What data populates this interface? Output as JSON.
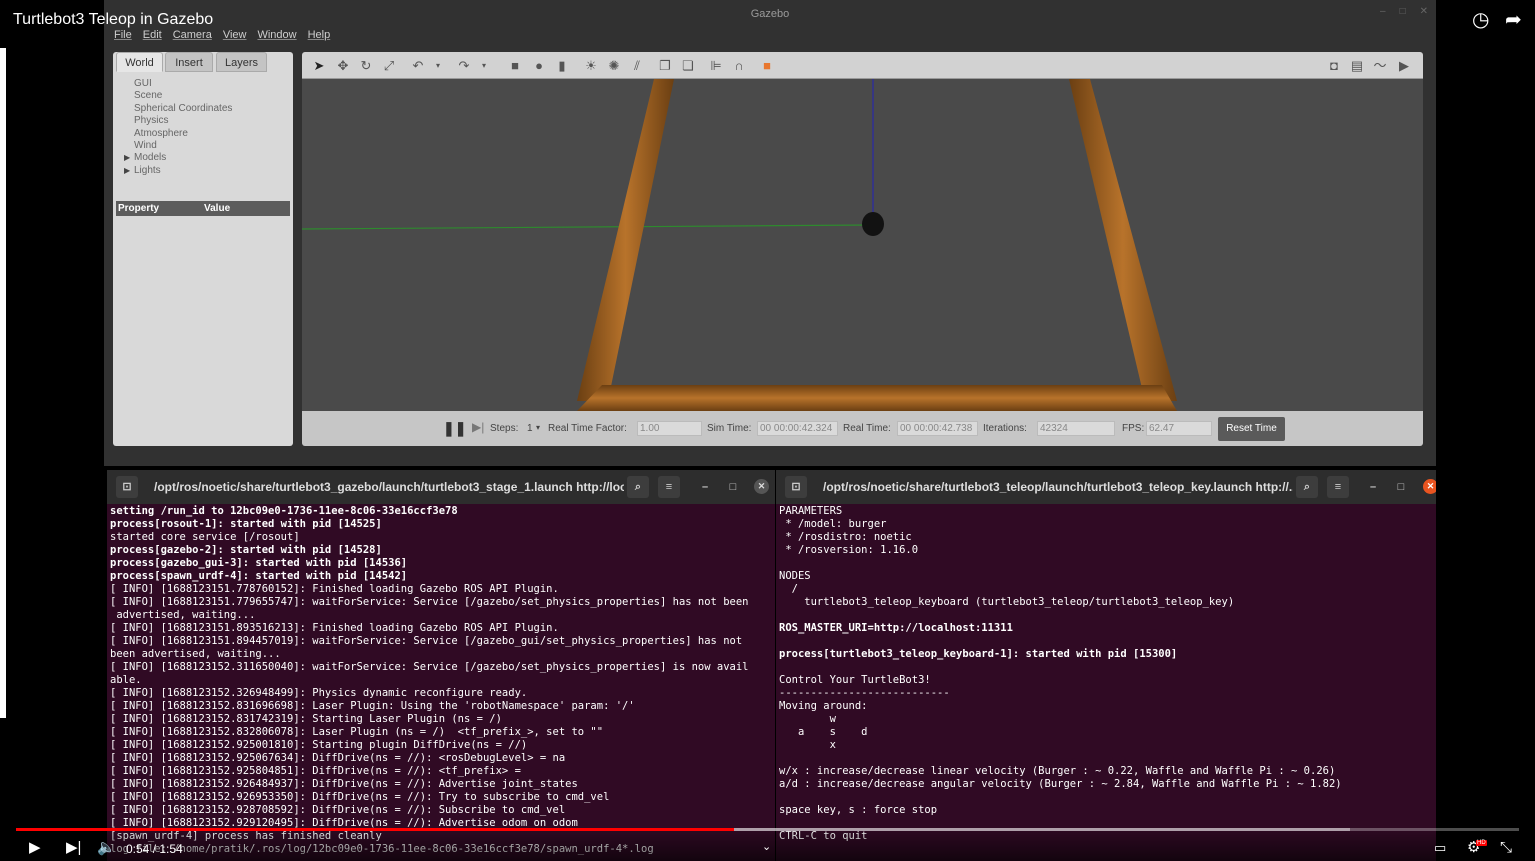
{
  "video": {
    "title": "Turtlebot3 Teleop in Gazebo",
    "time": "0:54 / 1:54",
    "progress": 0.474,
    "buffered": 0.887,
    "hd_badge": "HD"
  },
  "gazebo": {
    "window_title": "Gazebo",
    "menu": [
      "File",
      "Edit",
      "Camera",
      "View",
      "Window",
      "Help"
    ],
    "tabs": [
      "World",
      "Insert",
      "Layers"
    ],
    "tree": [
      {
        "label": "GUI",
        "expandable": false
      },
      {
        "label": "Scene",
        "expandable": false
      },
      {
        "label": "Spherical Coordinates",
        "expandable": false
      },
      {
        "label": "Physics",
        "expandable": false
      },
      {
        "label": "Atmosphere",
        "expandable": false
      },
      {
        "label": "Wind",
        "expandable": false
      },
      {
        "label": "Models",
        "expandable": true
      },
      {
        "label": "Lights",
        "expandable": true
      }
    ],
    "property_header": {
      "property": "Property",
      "value": "Value"
    },
    "status": {
      "steps_label": "Steps:",
      "steps_value": "1",
      "rtf_label": "Real Time Factor:",
      "rtf_value": "1.00",
      "sim_time_label": "Sim Time:",
      "sim_time_value": "00 00:00:42.324",
      "real_time_label": "Real Time:",
      "real_time_value": "00 00:00:42.738",
      "iterations_label": "Iterations:",
      "iterations_value": "42324",
      "fps_label": "FPS:",
      "fps_value": "62.47",
      "reset_label": "Reset Time"
    }
  },
  "terminal_left": {
    "title": "/opt/ros/noetic/share/turtlebot3_gazebo/launch/turtlebot3_stage_1.launch http://loc...",
    "lines": [
      {
        "t": "setting /run_id to 12bc09e0-1736-11ee-8c06-33e16ccf3e78",
        "b": true
      },
      {
        "t": "process[rosout-1]: started with pid [14525]",
        "b": true
      },
      {
        "t": "started core service [/rosout]",
        "b": false
      },
      {
        "t": "process[gazebo-2]: started with pid [14528]",
        "b": true
      },
      {
        "t": "process[gazebo_gui-3]: started with pid [14536]",
        "b": true
      },
      {
        "t": "process[spawn_urdf-4]: started with pid [14542]",
        "b": true
      },
      {
        "t": "[ INFO] [1688123151.778760152]: Finished loading Gazebo ROS API Plugin.",
        "b": false
      },
      {
        "t": "[ INFO] [1688123151.779655747]: waitForService: Service [/gazebo/set_physics_properties] has not been",
        "b": false
      },
      {
        "t": " advertised, waiting...",
        "b": false
      },
      {
        "t": "[ INFO] [1688123151.893516213]: Finished loading Gazebo ROS API Plugin.",
        "b": false
      },
      {
        "t": "[ INFO] [1688123151.894457019]: waitForService: Service [/gazebo_gui/set_physics_properties] has not",
        "b": false
      },
      {
        "t": "been advertised, waiting...",
        "b": false
      },
      {
        "t": "[ INFO] [1688123152.311650040]: waitForService: Service [/gazebo/set_physics_properties] is now avail",
        "b": false
      },
      {
        "t": "able.",
        "b": false
      },
      {
        "t": "[ INFO] [1688123152.326948499]: Physics dynamic reconfigure ready.",
        "b": false
      },
      {
        "t": "[ INFO] [1688123152.831696698]: Laser Plugin: Using the 'robotNamespace' param: '/'",
        "b": false
      },
      {
        "t": "[ INFO] [1688123152.831742319]: Starting Laser Plugin (ns = /)",
        "b": false
      },
      {
        "t": "[ INFO] [1688123152.832806078]: Laser Plugin (ns = /)  <tf_prefix_>, set to \"\"",
        "b": false
      },
      {
        "t": "[ INFO] [1688123152.925001810]: Starting plugin DiffDrive(ns = //)",
        "b": false
      },
      {
        "t": "[ INFO] [1688123152.925067634]: DiffDrive(ns = //): <rosDebugLevel> = na",
        "b": false
      },
      {
        "t": "[ INFO] [1688123152.925804851]: DiffDrive(ns = //): <tf_prefix> =",
        "b": false
      },
      {
        "t": "[ INFO] [1688123152.926484937]: DiffDrive(ns = //): Advertise joint_states",
        "b": false
      },
      {
        "t": "[ INFO] [1688123152.926953350]: DiffDrive(ns = //): Try to subscribe to cmd_vel",
        "b": false
      },
      {
        "t": "[ INFO] [1688123152.928708592]: DiffDrive(ns = //): Subscribe to cmd_vel",
        "b": false
      },
      {
        "t": "[ INFO] [1688123152.929120495]: DiffDrive(ns = //): Advertise odom on odom",
        "b": false
      },
      {
        "t": "[spawn_urdf-4] process has finished cleanly",
        "b": false
      },
      {
        "t": "log file: /home/pratik/.ros/log/12bc09e0-1736-11ee-8c06-33e16ccf3e78/spawn_urdf-4*.log",
        "b": false
      }
    ]
  },
  "terminal_right": {
    "title": "/opt/ros/noetic/share/turtlebot3_teleop/launch/turtlebot3_teleop_key.launch http://...",
    "lines": [
      {
        "t": "PARAMETERS",
        "b": false
      },
      {
        "t": " * /model: burger",
        "b": false
      },
      {
        "t": " * /rosdistro: noetic",
        "b": false
      },
      {
        "t": " * /rosversion: 1.16.0",
        "b": false
      },
      {
        "t": "",
        "b": false
      },
      {
        "t": "NODES",
        "b": false
      },
      {
        "t": "  /",
        "b": false
      },
      {
        "t": "    turtlebot3_teleop_keyboard (turtlebot3_teleop/turtlebot3_teleop_key)",
        "b": false
      },
      {
        "t": "",
        "b": false
      },
      {
        "t": "ROS_MASTER_URI=http://localhost:11311",
        "b": true
      },
      {
        "t": "",
        "b": false
      },
      {
        "t": "process[turtlebot3_teleop_keyboard-1]: started with pid [15300]",
        "b": true
      },
      {
        "t": "",
        "b": false
      },
      {
        "t": "Control Your TurtleBot3!",
        "b": false
      },
      {
        "t": "---------------------------",
        "b": false
      },
      {
        "t": "Moving around:",
        "b": false
      },
      {
        "t": "        w",
        "b": false
      },
      {
        "t": "   a    s    d",
        "b": false
      },
      {
        "t": "        x",
        "b": false
      },
      {
        "t": "",
        "b": false
      },
      {
        "t": "w/x : increase/decrease linear velocity (Burger : ~ 0.22, Waffle and Waffle Pi : ~ 0.26)",
        "b": false
      },
      {
        "t": "a/d : increase/decrease angular velocity (Burger : ~ 2.84, Waffle and Waffle Pi : ~ 1.82)",
        "b": false
      },
      {
        "t": "",
        "b": false
      },
      {
        "t": "space key, s : force stop",
        "b": false
      },
      {
        "t": "",
        "b": false
      },
      {
        "t": "CTRL-C to quit",
        "b": false
      }
    ]
  },
  "colors": {
    "terminal_bg": "#300a24",
    "progress": "#ff0000",
    "close_button": "#e95420"
  }
}
